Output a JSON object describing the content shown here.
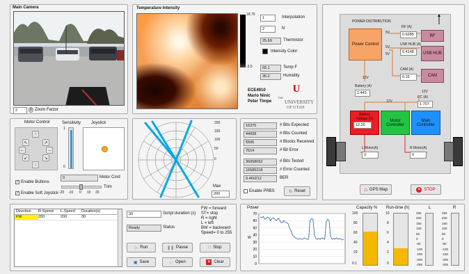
{
  "camera": {
    "title": "Main Camera",
    "zoom_value": "2",
    "zoom_label": "Zoom Factor"
  },
  "temperature": {
    "title": "Temperature Intensity",
    "scale_max": "18.75",
    "scale_min": "-3.5",
    "interpolation_value": "1",
    "interpolation_label": "Interpolation",
    "n_value": "2",
    "n_label": "N",
    "thermistor_value": "25.69",
    "thermistor_label": "Thermistor",
    "intensity_color_label": "Intensity Color",
    "tempf_value": "65.1",
    "tempf_label": "Temp F",
    "humidity_value": "35.2",
    "humidity_label": "Humidity",
    "credits": [
      "ECE4910",
      "Mario Ninic",
      "Peter Timpe"
    ],
    "university": [
      "THE",
      "UNIVERSITY",
      "OF UTAH"
    ],
    "logo_letter": "U"
  },
  "power_dist": {
    "title": "POWER DISTRIBUTION",
    "power_control": "Power Control",
    "rf_label": "RF (A)",
    "rf_value": "0.6285",
    "rf_box": "RF",
    "usb_label": "USB HUB (A)",
    "usb_value": "0.4148",
    "usb_box": "USB HUB",
    "cam_label": "CAM (A)",
    "cam_value": "0.15",
    "cam_box": "CAM",
    "v5": "5V",
    "v12": "12V",
    "battery_label": "Battery (A)",
    "battery_value": "2.443",
    "pc_label": "PC (A)",
    "pc_value": "1.707",
    "battery_box": "Battery",
    "battery_voltage_label": "Voltage (V)",
    "battery_voltage": "12.26",
    "motor_controller": "Motor Controller",
    "main_controller": "Main Controller",
    "lmotor_label": "L Motor(A)",
    "lmotor_value": "0",
    "rmotor_label": "R Motor(A)",
    "rmotor_value": "0",
    "gps_button": "GPS Map",
    "stop_button": "STOP"
  },
  "motor_control": {
    "title": "Motor Control",
    "sensitivity_label": "Sensitivity",
    "sens_ticks": [
      "1",
      "0"
    ],
    "sensitivity_level": 0.95,
    "joystick_label": "Joystick",
    "motor_cmd_value": "0",
    "motor_cmd_label": "Motor Cmd",
    "enable_buttons": "Enable Buttons",
    "enable_soft_joystick": "Enable Soft Joystick",
    "trim_label": "Trim",
    "trim_ticks": [
      "-20",
      "-10",
      "0",
      "10",
      "20"
    ]
  },
  "lidar": {
    "rings": [
      "200",
      "150",
      "100",
      "50",
      "0"
    ],
    "max_label": "Max",
    "max_value": "200"
  },
  "bits": {
    "rows": [
      {
        "value": "16376",
        "label": "# Bits Expected"
      },
      {
        "value": "44008",
        "label": "# Bits Counted"
      },
      {
        "value": "5506",
        "label": "# Blocks Received"
      },
      {
        "value": "7614",
        "label": "# Bit Error"
      },
      {
        "value": "36058052",
        "label": "# Bits Tested"
      },
      {
        "value": "16585218",
        "label": "# Error Counted"
      },
      {
        "value": "0.460212",
        "label": "BER"
      }
    ],
    "enable_prbs": "Enable PRBS",
    "reset": "Reset"
  },
  "script": {
    "columns": [
      "Direction",
      "R-Speed",
      "L-Speed",
      "Duration(s)"
    ],
    "rows": [
      [
        "FW",
        "200",
        "200",
        "30"
      ]
    ],
    "duration_value": "30",
    "duration_label": "Script duration (s)",
    "status_value": "Ready",
    "status_label": "Status",
    "legend": [
      "FW = forward",
      "ST= stop",
      "R = right",
      "L = left",
      "BW = backward",
      "Speed= 0 to 255"
    ],
    "run": "Run",
    "pause": "Pause",
    "stop": "Stop",
    "save": "Save",
    "open": "Open",
    "clear": "Clear"
  },
  "power": {
    "title": "Power",
    "ylabel": "W",
    "capacity_label": "Capacity %",
    "capacity_ticks": [
      "100",
      "80",
      "60",
      "40",
      "20",
      "0.1"
    ],
    "capacity_level": 0.65,
    "runtime_label": "Run-time (h)",
    "runtime_ticks": [
      "10",
      "8",
      "6",
      "4",
      "2",
      "0"
    ],
    "runtime_level": 0.33,
    "l_label": "L",
    "r_label": "R",
    "lr_ticks": [
      "255",
      "200",
      "150",
      "100",
      "50",
      "0",
      "-50",
      "-100",
      "-150",
      "-200",
      "-255"
    ]
  },
  "chart_data": {
    "type": "line",
    "ylim": [
      0,
      70
    ],
    "yticks": [
      "70",
      "60",
      "50",
      "40",
      "30",
      "20",
      "10",
      "0"
    ],
    "values": [
      65,
      64,
      66,
      62,
      63,
      65,
      64,
      60,
      63,
      64,
      62,
      60,
      63,
      62,
      58,
      57,
      60,
      58,
      57,
      56,
      50,
      46,
      40,
      38,
      36,
      35,
      34,
      35,
      34,
      34,
      36,
      35,
      34,
      34,
      60,
      63,
      62,
      40,
      35,
      34,
      35,
      34,
      36,
      35,
      34,
      58,
      62,
      60,
      38,
      34,
      35,
      34,
      36,
      34,
      35,
      34,
      33,
      34
    ]
  }
}
